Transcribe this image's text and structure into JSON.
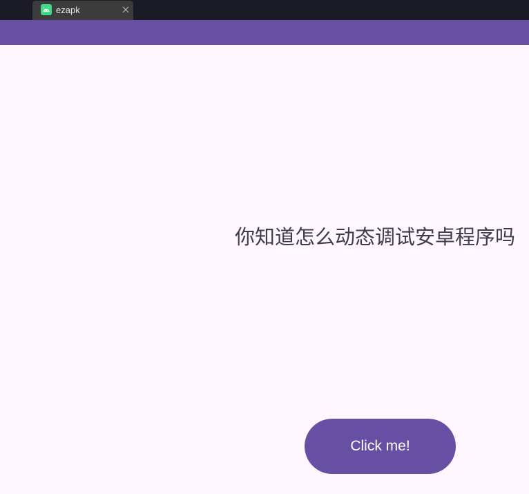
{
  "window": {
    "tab_title": "ezapk",
    "tab_icon": "android-icon",
    "close_icon": "close-icon"
  },
  "main": {
    "message": "你知道怎么动态调试安卓程序吗",
    "button_label": "Click me!"
  },
  "colors": {
    "app_bar": "#6750a4",
    "background": "#fef7ff",
    "button": "#6750a4",
    "tab_strip": "#1a1b24",
    "tab": "#3c3c3c",
    "android_green": "#3ddc84"
  }
}
